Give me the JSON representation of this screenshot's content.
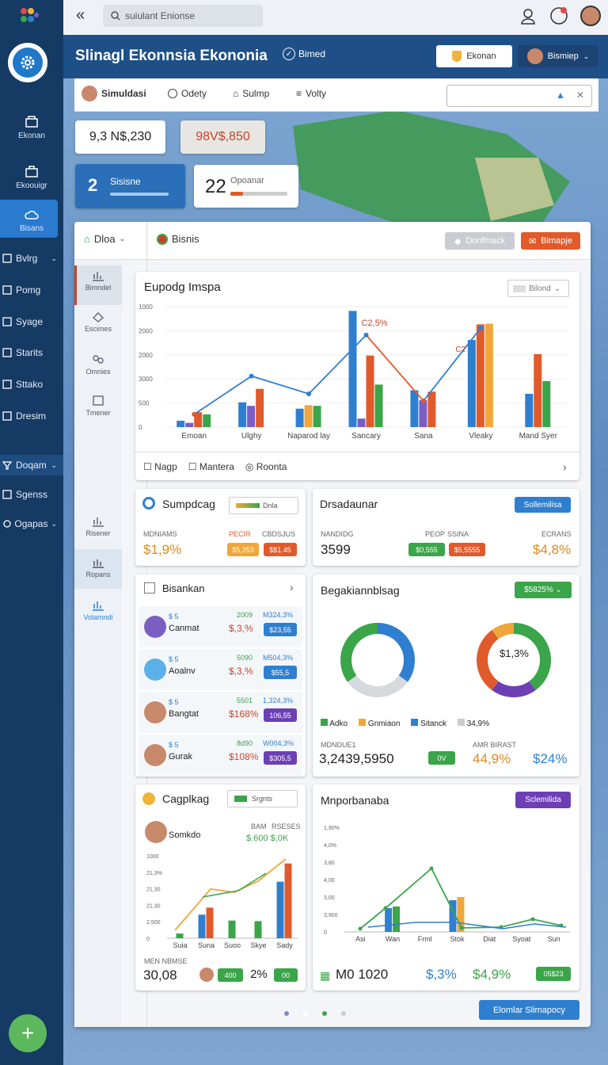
{
  "topbar": {
    "search_placeholder": "suiulant Enionse"
  },
  "banner": {
    "title": "Slinagl Ekonnsia Ekononia",
    "title_tag": "Bimed",
    "btn_ekonan": "Ekonan",
    "user_label": "Bismiep"
  },
  "sidebar": {
    "items": [
      {
        "label": "Ekonan"
      },
      {
        "label": "Ekoouigr"
      },
      {
        "label": "Bisans"
      }
    ],
    "rows": [
      {
        "label": "Bvlrg",
        "chevron": true
      },
      {
        "label": "Pomg"
      },
      {
        "label": "Syage"
      },
      {
        "label": "Starits"
      },
      {
        "label": "Sttako"
      },
      {
        "label": "Dresim"
      },
      {
        "label": "Doqam",
        "chevron": true
      },
      {
        "label": "Sgenss"
      },
      {
        "label": "Ogapas",
        "chevron": true
      }
    ]
  },
  "toolbar": {
    "user": "Simuldasi",
    "tab1": "Odety",
    "tab2": "Sulmp",
    "tab3": "Volty"
  },
  "stats": {
    "val1": "9,3 N$,230",
    "val2": "98V$,850",
    "badge_num": "2",
    "badge_label": "Sisisne",
    "count": "22",
    "count_label": "Opoanar"
  },
  "panel": {
    "dropdown": "Dloa",
    "tab": "Bisnis",
    "btn_gray": "Donfmack",
    "btn_red": "Bimapje"
  },
  "leftnav": [
    {
      "label": "Bimndel"
    },
    {
      "label": "Escimes"
    },
    {
      "label": "Omnies"
    },
    {
      "label": "Tmener"
    },
    {
      "label": "Risener"
    },
    {
      "label": "Ropans"
    },
    {
      "label": "Volamndi"
    }
  ],
  "main_chart": {
    "title": "Eupodg Imspa",
    "select": "Bilond",
    "annot_top": "C2,5%",
    "annot_right": "C2",
    "footer_links": [
      "Nagp",
      "Mantera",
      "Roonta"
    ]
  },
  "chart_data": [
    {
      "type": "bar",
      "title": "Eupodg Imspa",
      "categories": [
        "Emoan",
        "Ulghy",
        "Naparod lay",
        "Sancary",
        "Sana",
        "Vleaky",
        "Mand Syer"
      ],
      "yticks": [
        "1000",
        "2000",
        "2000",
        "3000",
        "500",
        "0"
      ],
      "series": [
        {
          "color": "#2f7fd0",
          "values": [
            90,
            350,
            260,
            1640,
            520,
            1230,
            470
          ]
        },
        {
          "color": "#7b5ec4",
          "values": [
            60,
            300,
            0,
            120,
            380,
            0,
            0
          ]
        },
        {
          "color": "#e05a2b",
          "values": [
            210,
            540,
            0,
            1010,
            500,
            1450,
            1030
          ]
        },
        {
          "color": "#f0a63a",
          "values": [
            0,
            0,
            310,
            0,
            0,
            1460,
            0
          ]
        },
        {
          "color": "#3aa549",
          "values": [
            180,
            0,
            300,
            600,
            0,
            0,
            650
          ]
        }
      ],
      "line": {
        "color": "#2f7fd0",
        "values": [
          180,
          720,
          470,
          1300,
          370,
          1400
        ]
      }
    },
    {
      "type": "bar",
      "categories": [
        "Suia",
        "Suna",
        "Suoo",
        "Skye",
        "Sady"
      ],
      "yticks": [
        "1000",
        "21,3%",
        "21,30",
        "21,30",
        "2,500",
        "0"
      ],
      "series": [
        {
          "color": "#2f7fd0",
          "values": [
            0,
            400,
            0,
            0,
            960
          ]
        },
        {
          "color": "#7b5ec4",
          "values": [
            0,
            0,
            0,
            0,
            0
          ]
        },
        {
          "color": "#e05a2b",
          "values": [
            0,
            520,
            0,
            0,
            1270
          ]
        },
        {
          "color": "#3aa549",
          "values": [
            80,
            0,
            300,
            290,
            0
          ]
        }
      ]
    },
    {
      "type": "line",
      "categories": [
        "Asi",
        "Wan",
        "Frml",
        "Stok",
        "Diat",
        "Syoat",
        "Sun"
      ],
      "yticks": [
        "1,90%",
        "4,0%",
        "3,80",
        "4,00",
        "3,00",
        "3,900",
        "0"
      ]
    }
  ],
  "card_sump": {
    "title": "Sumpdcag",
    "chip": "Dnla",
    "labels": [
      "MDNIAMS",
      "PECIR",
      "CBDSJUS"
    ],
    "value": "$1,9%",
    "pills": [
      "$5,253",
      "$$1.45"
    ]
  },
  "card_drs": {
    "title": "Drsadaunar",
    "button": "Sollemilisa",
    "labels": [
      "NANDIDG",
      "PEOP",
      "SSINA",
      "ECRANS"
    ],
    "value": "3599",
    "pills": [
      "$0,555",
      "$5,5555"
    ],
    "right_val": "$4,8%"
  },
  "card_list": {
    "title": "Bisankan",
    "rows": [
      {
        "name": "Canmat",
        "tag": "$ 5",
        "n1": "2009",
        "n2": "M324,3%",
        "pct": "$,3,%",
        "pill": "$23,55",
        "pcolor": "#2f7fd0"
      },
      {
        "name": "Aoalnv",
        "tag": "$ 5",
        "n1": "5090",
        "n2": "M504,3%",
        "pct": "$,3,%",
        "pill": "$55,5",
        "pcolor": "#2f7fd0"
      },
      {
        "name": "Bangtat",
        "tag": "$ 5",
        "n1": "5501",
        "n2": "1,324,3%",
        "pct": "$168%",
        "pill": "106,55",
        "pcolor": "#6c3fb5"
      },
      {
        "name": "Gurak",
        "tag": "$ 5",
        "n1": "8d90",
        "n2": "W004,3%",
        "pct": "$108%",
        "pill": "$305,5",
        "pcolor": "#6c3fb5"
      }
    ]
  },
  "card_donut": {
    "title": "Begakiannblsag",
    "chip": "$5825%",
    "center": "$1,3%",
    "legend": [
      "Adko",
      "Gnmiaon",
      "Sitanck",
      "34,9%"
    ],
    "labels": [
      "MDNDUE1",
      "AMR BIRAST"
    ],
    "value": "3,2439,5950",
    "pill": "0V",
    "pct1": "44,9%",
    "pct2": "$24%",
    "donut1": [
      {
        "c": "#2f7fd0",
        "v": 35
      },
      {
        "c": "#d6d9de",
        "v": 30
      },
      {
        "c": "#3aa549",
        "v": 35
      }
    ],
    "donut2": [
      {
        "c": "#3aa549",
        "v": 40
      },
      {
        "c": "#6c3fb5",
        "v": 20
      },
      {
        "c": "#e05a2b",
        "v": 30
      },
      {
        "c": "#f0a63a",
        "v": 10
      }
    ]
  },
  "card_cag": {
    "title": "Cagplkag",
    "chip": "Srgnts",
    "user": "Somkdo",
    "labels": [
      "BAM",
      "RSESES"
    ],
    "sub": "$.600 $,0K",
    "value": "30,08",
    "pill1": "400",
    "pct": "2%",
    "pill2": "00",
    "footer_btn": "Elomlar Slimapocy"
  },
  "card_mpor": {
    "title": "Mnporbanaba",
    "button": "Sclemilida",
    "value": "M0 1020",
    "pct1": "$,3%",
    "pct2": "$4,9%",
    "pill": "05$23"
  }
}
